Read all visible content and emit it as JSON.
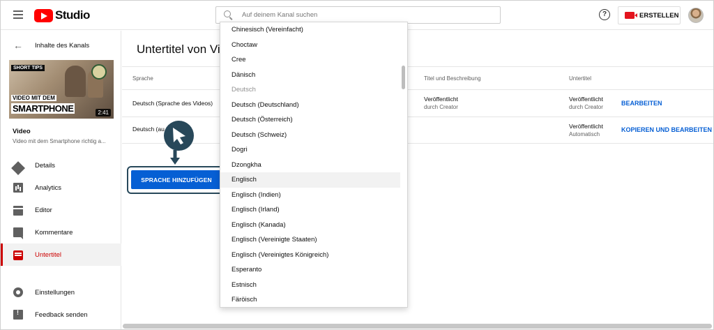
{
  "header": {
    "logo_text": "Studio",
    "search_placeholder": "Auf deinem Kanal suchen",
    "help_glyph": "?",
    "create_label": "ERSTELLEN"
  },
  "sidebar": {
    "back_label": "Inhalte des Kanals",
    "thumbnail": {
      "badge": "SHORT TIPS",
      "title_line1": "VIDEO MIT DEM",
      "title_line2": "SMARTPHONE",
      "duration": "2:41"
    },
    "video_label": "Video",
    "video_title": "Video mit dem Smartphone richtig a...",
    "items": [
      {
        "label": "Details",
        "icon": "pencil-icon"
      },
      {
        "label": "Analytics",
        "icon": "analytics-icon"
      },
      {
        "label": "Editor",
        "icon": "clapper-icon"
      },
      {
        "label": "Kommentare",
        "icon": "comment-icon"
      },
      {
        "label": "Untertitel",
        "icon": "subtitles-icon",
        "active": true
      },
      {
        "label": "Einstellungen",
        "icon": "gear-icon"
      },
      {
        "label": "Feedback senden",
        "icon": "feedback-icon"
      }
    ]
  },
  "main": {
    "title": "Untertitel von Vi",
    "columns": {
      "language": "Sprache",
      "title_desc": "Titel und Beschreibung",
      "subtitles": "Untertitel"
    },
    "rows": [
      {
        "language": "Deutsch (Sprache des Videos)",
        "title_desc_status": "Veröffentlicht",
        "title_desc_by": "durch Creator",
        "sub_status": "Veröffentlicht",
        "sub_by": "durch Creator",
        "action": "BEARBEITEN"
      },
      {
        "language": "Deutsch (au",
        "sub_status": "Veröffentlicht",
        "sub_by": "Automatisch",
        "action": "KOPIEREN UND BEARBEITEN"
      }
    ],
    "add_language_label": "SPRACHE HINZUFÜGEN"
  },
  "dropdown": {
    "options": [
      "Chinesisch (Vereinfacht)",
      "Choctaw",
      "Cree",
      "Dänisch",
      "Deutsch",
      "Deutsch (Deutschland)",
      "Deutsch (Österreich)",
      "Deutsch (Schweiz)",
      "Dogri",
      "Dzongkha",
      "Englisch",
      "Englisch (Indien)",
      "Englisch (Irland)",
      "Englisch (Kanada)",
      "Englisch (Vereinigte Staaten)",
      "Englisch (Vereinigtes Königreich)",
      "Esperanto",
      "Estnisch",
      "Färöisch"
    ],
    "disabled_option": "Deutsch",
    "highlighted_option": "Englisch"
  },
  "colors": {
    "brand_red": "#ff0000",
    "active_red": "#cc0000",
    "link_blue": "#065fd4",
    "annotation_navy": "#28485a"
  }
}
